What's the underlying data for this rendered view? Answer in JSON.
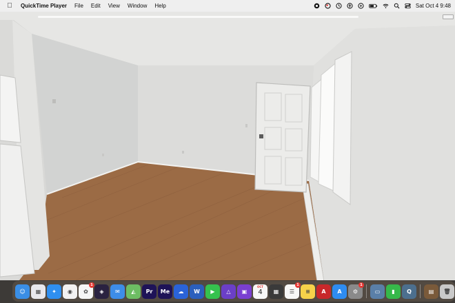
{
  "menubar": {
    "app_name": "QuickTime Player",
    "menus": [
      "File",
      "Edit",
      "View",
      "Window",
      "Help"
    ],
    "clock": "Sat Oct 4  9:48",
    "tray_icons": [
      "creative-cloud-icon",
      "maps-icon",
      "time-machine-icon",
      "accessibility-icon",
      "play-icon",
      "battery-icon",
      "wifi-icon",
      "search-icon",
      "control-center-icon"
    ]
  },
  "video": {
    "content": "room",
    "colors": {
      "wall": "#d9d9d7",
      "floor": "#9a6a45",
      "door": "#ececea"
    }
  },
  "dock": {
    "apps": [
      {
        "name": "finder-icon",
        "color": "#3a8ee6",
        "glyph": "☺"
      },
      {
        "name": "launchpad-icon",
        "color": "#e8e8ec",
        "glyph": "▦"
      },
      {
        "name": "safari-icon",
        "color": "#2f8ff0",
        "glyph": "✦"
      },
      {
        "name": "chrome-icon",
        "color": "#f2f2f2",
        "glyph": "◉"
      },
      {
        "name": "photos-icon",
        "color": "#f6f6f6",
        "glyph": "✿",
        "badge": "1"
      },
      {
        "name": "topaz-icon",
        "color": "#2a2240",
        "glyph": "◈"
      },
      {
        "name": "mail-icon",
        "color": "#3d8de8",
        "glyph": "✉"
      },
      {
        "name": "maps-icon",
        "color": "#6dbd63",
        "glyph": "◭"
      },
      {
        "name": "premiere-icon",
        "color": "#1e1357",
        "glyph": "Pr"
      },
      {
        "name": "media-encoder-icon",
        "color": "#1e1357",
        "glyph": "Me"
      },
      {
        "name": "creative-cloud-icon",
        "color": "#2a63d8",
        "glyph": "☁"
      },
      {
        "name": "word-icon",
        "color": "#2b5fbd",
        "glyph": "W"
      },
      {
        "name": "facetime-icon",
        "color": "#35c24e",
        "glyph": "▶"
      },
      {
        "name": "affinity-icon",
        "color": "#6b3fc7",
        "glyph": "△"
      },
      {
        "name": "screen-recorder-icon",
        "color": "#7a3fd1",
        "glyph": "▣"
      },
      {
        "name": "calendar-icon",
        "color": "#f7f7f7",
        "glyph": "",
        "month": "OCT",
        "day": "4"
      },
      {
        "name": "calculator-icon",
        "color": "#3a3a3a",
        "glyph": "▦"
      },
      {
        "name": "reminders-icon",
        "color": "#f7f7f7",
        "glyph": "☰",
        "badge": "1"
      },
      {
        "name": "notes-icon",
        "color": "#f6d24a",
        "glyph": "≡"
      },
      {
        "name": "acrobat-icon",
        "color": "#c8282a",
        "glyph": "A"
      },
      {
        "name": "app-store-icon",
        "color": "#2e8cf0",
        "glyph": "A"
      },
      {
        "name": "system-settings-icon",
        "color": "#8a8a8a",
        "glyph": "⚙",
        "badge": "1"
      }
    ],
    "recent_apps": [
      {
        "name": "preview-icon",
        "color": "#5a7fa8",
        "glyph": "▭"
      },
      {
        "name": "numbers-icon",
        "color": "#36b84a",
        "glyph": "▮"
      },
      {
        "name": "quicktime-icon",
        "color": "#4c6f8e",
        "glyph": "Q"
      }
    ],
    "trailing": [
      {
        "name": "downloads-stack-icon",
        "color": "#7a5a3a",
        "glyph": "▤"
      },
      {
        "name": "trash-icon",
        "color": "#c9c9c9",
        "glyph": "🗑"
      }
    ]
  }
}
